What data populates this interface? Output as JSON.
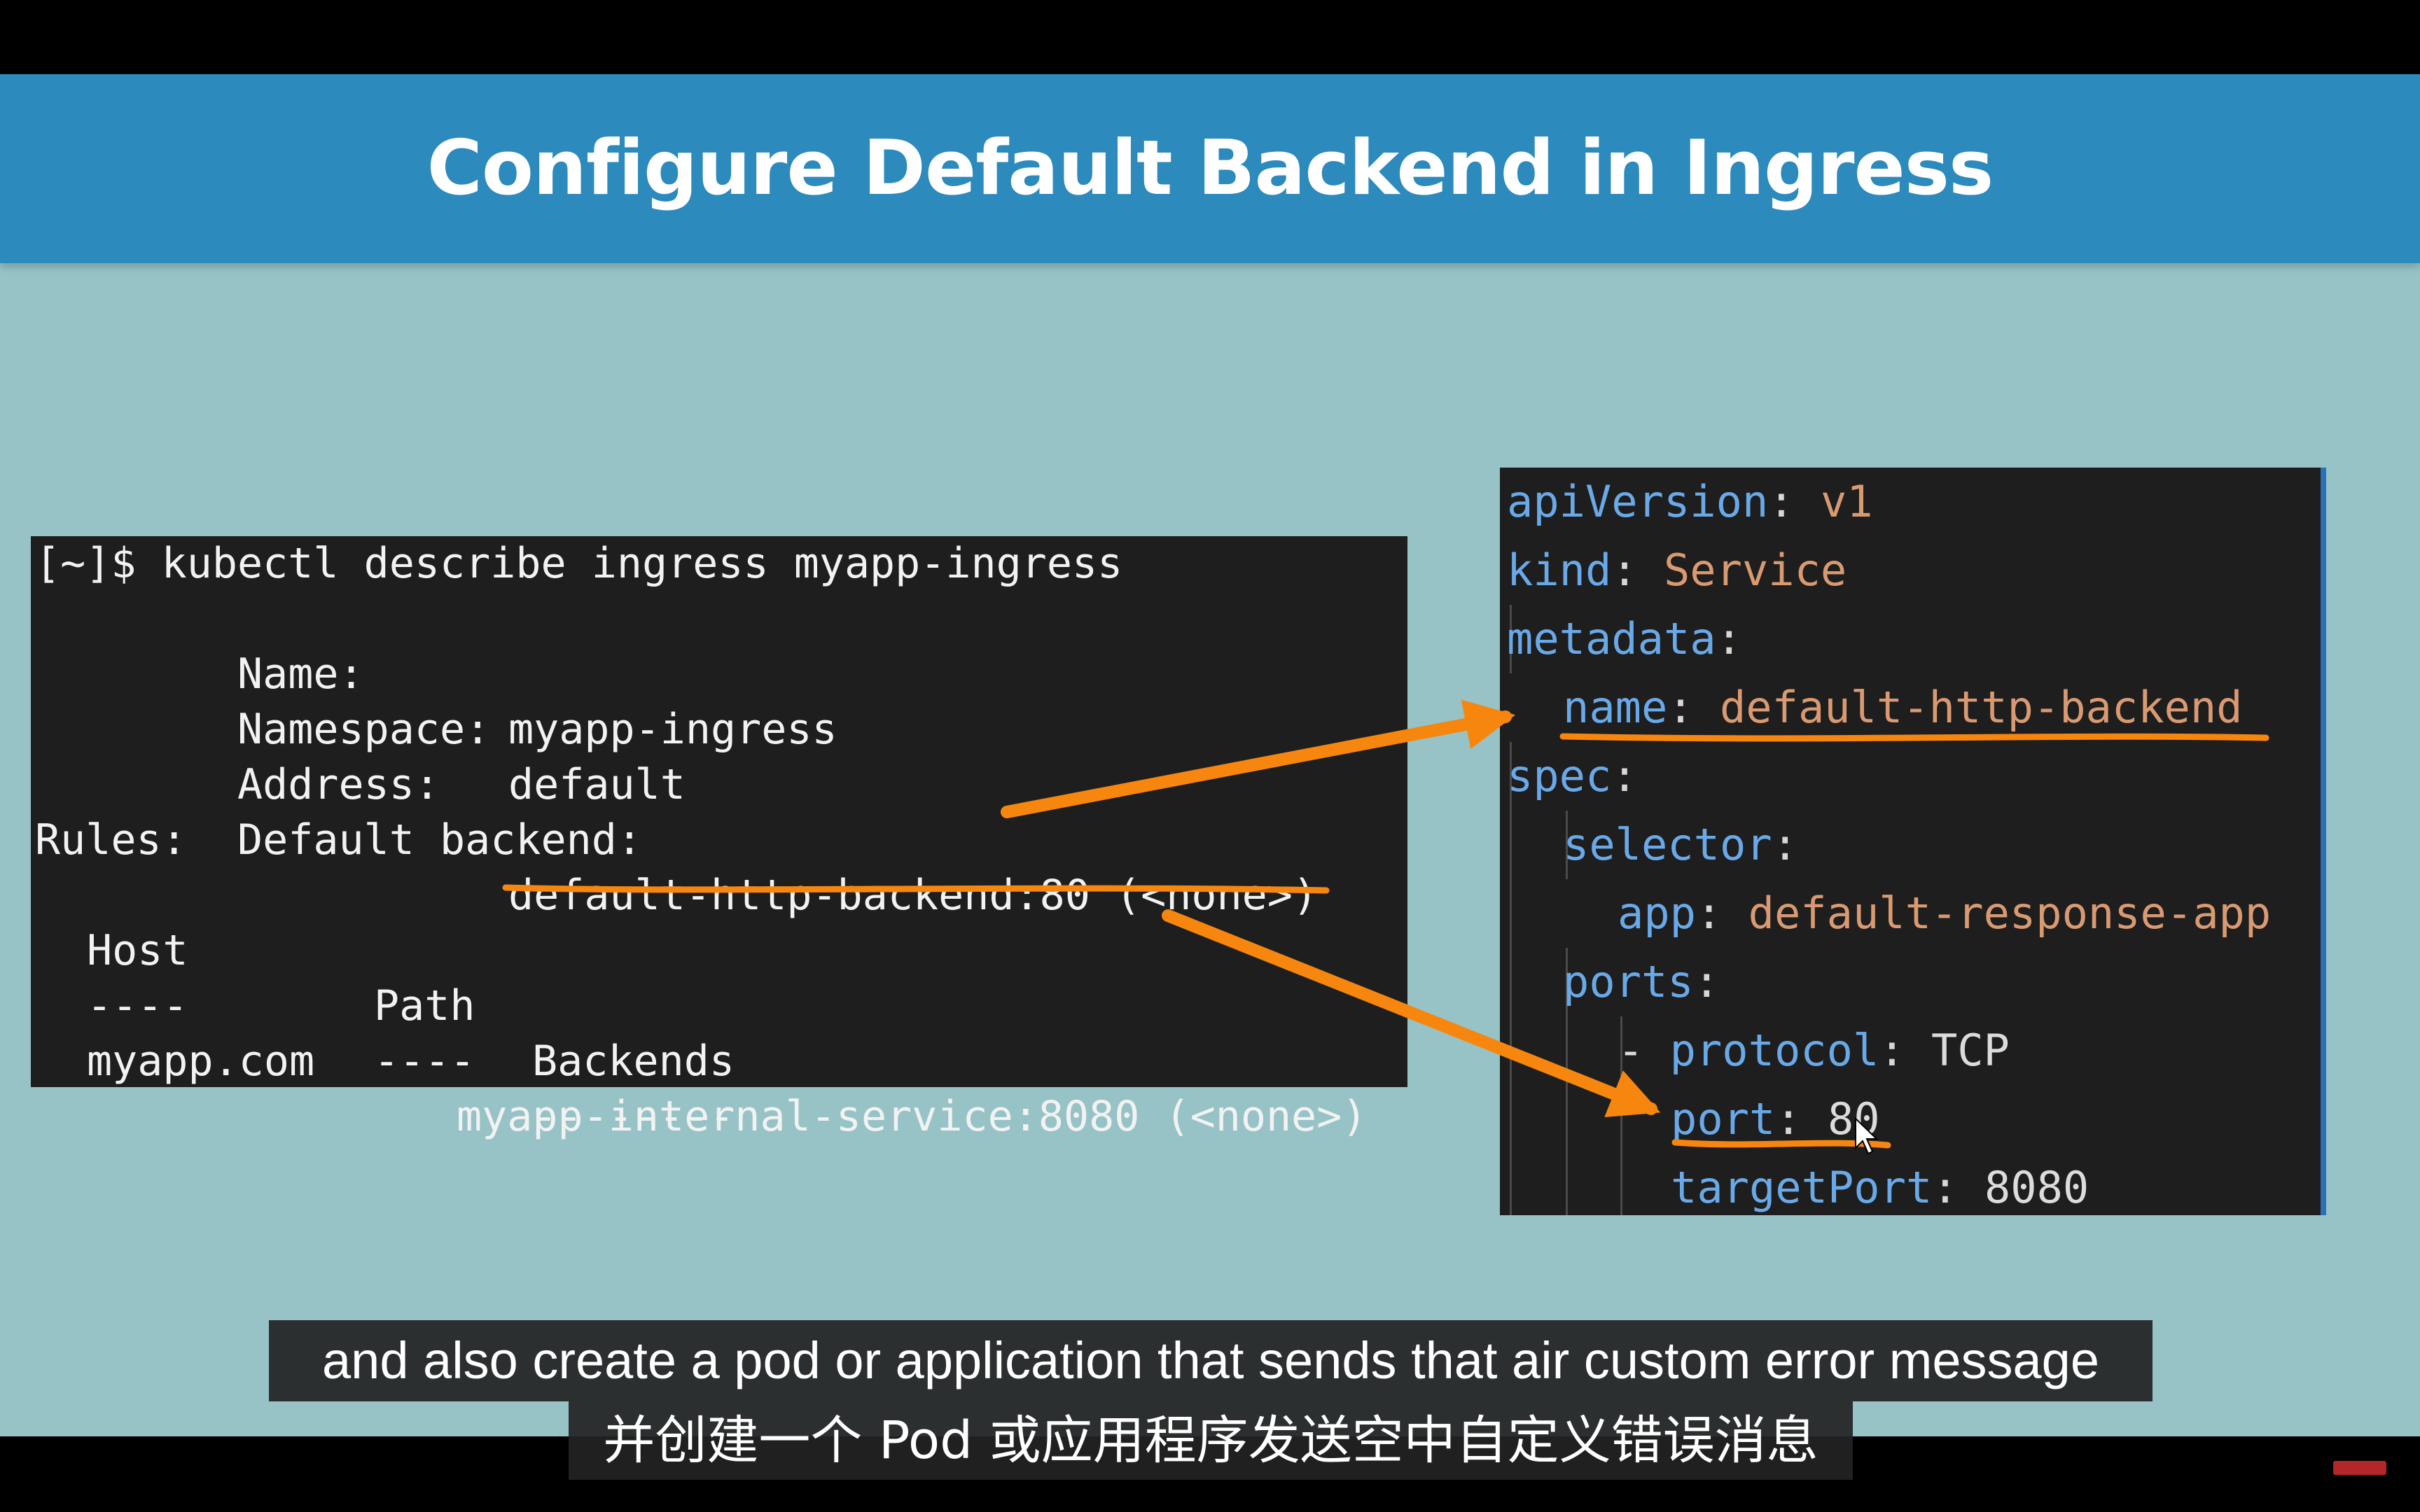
{
  "slide": {
    "title": "Configure Default Backend in Ingress"
  },
  "terminal": {
    "command": "[~]$ kubectl describe ingress myapp-ingress",
    "fields": [
      {
        "label": "Name:",
        "value": "myapp-ingress"
      },
      {
        "label": "Namespace:",
        "value": "default"
      },
      {
        "label": "Address:",
        "value": ""
      },
      {
        "label": "Default backend:",
        "value": "default-http-backend:80 (<none>)"
      }
    ],
    "rules_label": "Rules:",
    "rules_headers": [
      "Host",
      "Path",
      "Backends"
    ],
    "rules_dividers": [
      "----",
      "----",
      "--------"
    ],
    "rule_host": "myapp.com",
    "rule_backend": "myapp-internal-service:8080 (<none>)"
  },
  "yaml": {
    "apiVersion_key": "apiVersion",
    "apiVersion_val": "v1",
    "kind_key": "kind",
    "kind_val": "Service",
    "metadata_key": "metadata",
    "name_key": "name",
    "name_val": "default-http-backend",
    "spec_key": "spec",
    "selector_key": "selector",
    "app_key": "app",
    "app_val": "default-response-app",
    "ports_key": "ports",
    "protocol_key": "protocol",
    "protocol_val": "TCP",
    "port_key": "port",
    "port_val": "80",
    "targetPort_key": "targetPort",
    "targetPort_val": "8080"
  },
  "captions": {
    "english": "and also create a pod or application that sends that air custom error message",
    "chinese": "并创建一个 Pod 或应用程序发送空中自定义错误消息"
  },
  "colors": {
    "title_bar": "#2c8abd",
    "slide_background": "#97c3c7",
    "terminal_background": "#1e1e1e",
    "highlight_orange": "#f7860f",
    "yaml_key": "#6aa9e8",
    "yaml_value": "#d99a72"
  },
  "icons": {
    "annotation_arrows": "arrow-right",
    "cursor": "mouse-pointer-icon"
  }
}
